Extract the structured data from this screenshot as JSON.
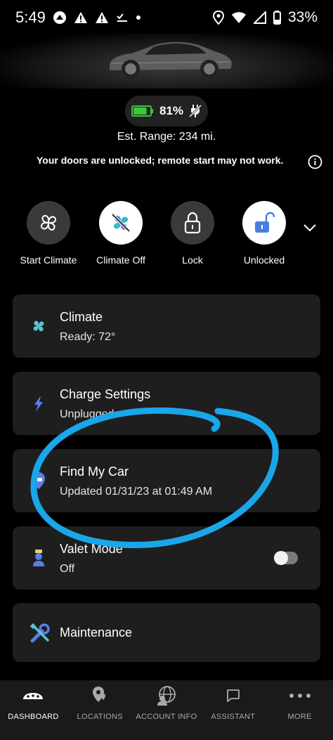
{
  "status_bar": {
    "time": "5:49",
    "battery_percent": "33%",
    "notification_icons": [
      "app-icon",
      "warning-icon",
      "warning-icon",
      "checklist-icon",
      "dot-icon"
    ],
    "system_icons": [
      "location-icon",
      "wifi-icon",
      "signal-icon",
      "battery-icon"
    ]
  },
  "vehicle": {
    "battery_level": "81%",
    "battery_fraction": 0.81,
    "est_range": "Est. Range: 234 mi.",
    "warning_text": "Your doors are unlocked; remote start may not work."
  },
  "quick_actions": [
    {
      "label": "Start Climate",
      "icon": "fan-icon",
      "style": "dark"
    },
    {
      "label": "Climate Off",
      "icon": "fan-off-icon",
      "style": "light"
    },
    {
      "label": "Lock",
      "icon": "lock-icon",
      "style": "dark"
    },
    {
      "label": "Unlocked",
      "icon": "unlock-icon",
      "style": "light"
    }
  ],
  "cards": {
    "climate": {
      "title": "Climate",
      "subtitle": "Ready: 72°",
      "icon": "fan-icon"
    },
    "charge": {
      "title": "Charge Settings",
      "subtitle": "Unplugged",
      "icon": "lightning-icon"
    },
    "find_car": {
      "title": "Find My Car",
      "subtitle": "Updated 01/31/23 at 01:49 AM",
      "icon": "car-location-icon"
    },
    "valet": {
      "title": "Valet Mode",
      "subtitle": "Off",
      "icon": "valet-icon",
      "toggle_on": false
    },
    "maintenance": {
      "title": "Maintenance",
      "icon": "wrench-icon"
    }
  },
  "bottom_nav": [
    {
      "label": "DASHBOARD",
      "icon": "car-icon",
      "active": true
    },
    {
      "label": "LOCATIONS",
      "icon": "map-pin-icon",
      "active": false
    },
    {
      "label": "ACCOUNT INFO",
      "icon": "account-globe-icon",
      "active": false
    },
    {
      "label": "ASSISTANT",
      "icon": "chat-icon",
      "active": false
    },
    {
      "label": "MORE",
      "icon": "more-icon",
      "active": false
    }
  ],
  "colors": {
    "background": "#000000",
    "card": "#1e1e1e",
    "battery_green": "#3ec63e",
    "annotation_blue": "#1aa6ea"
  }
}
